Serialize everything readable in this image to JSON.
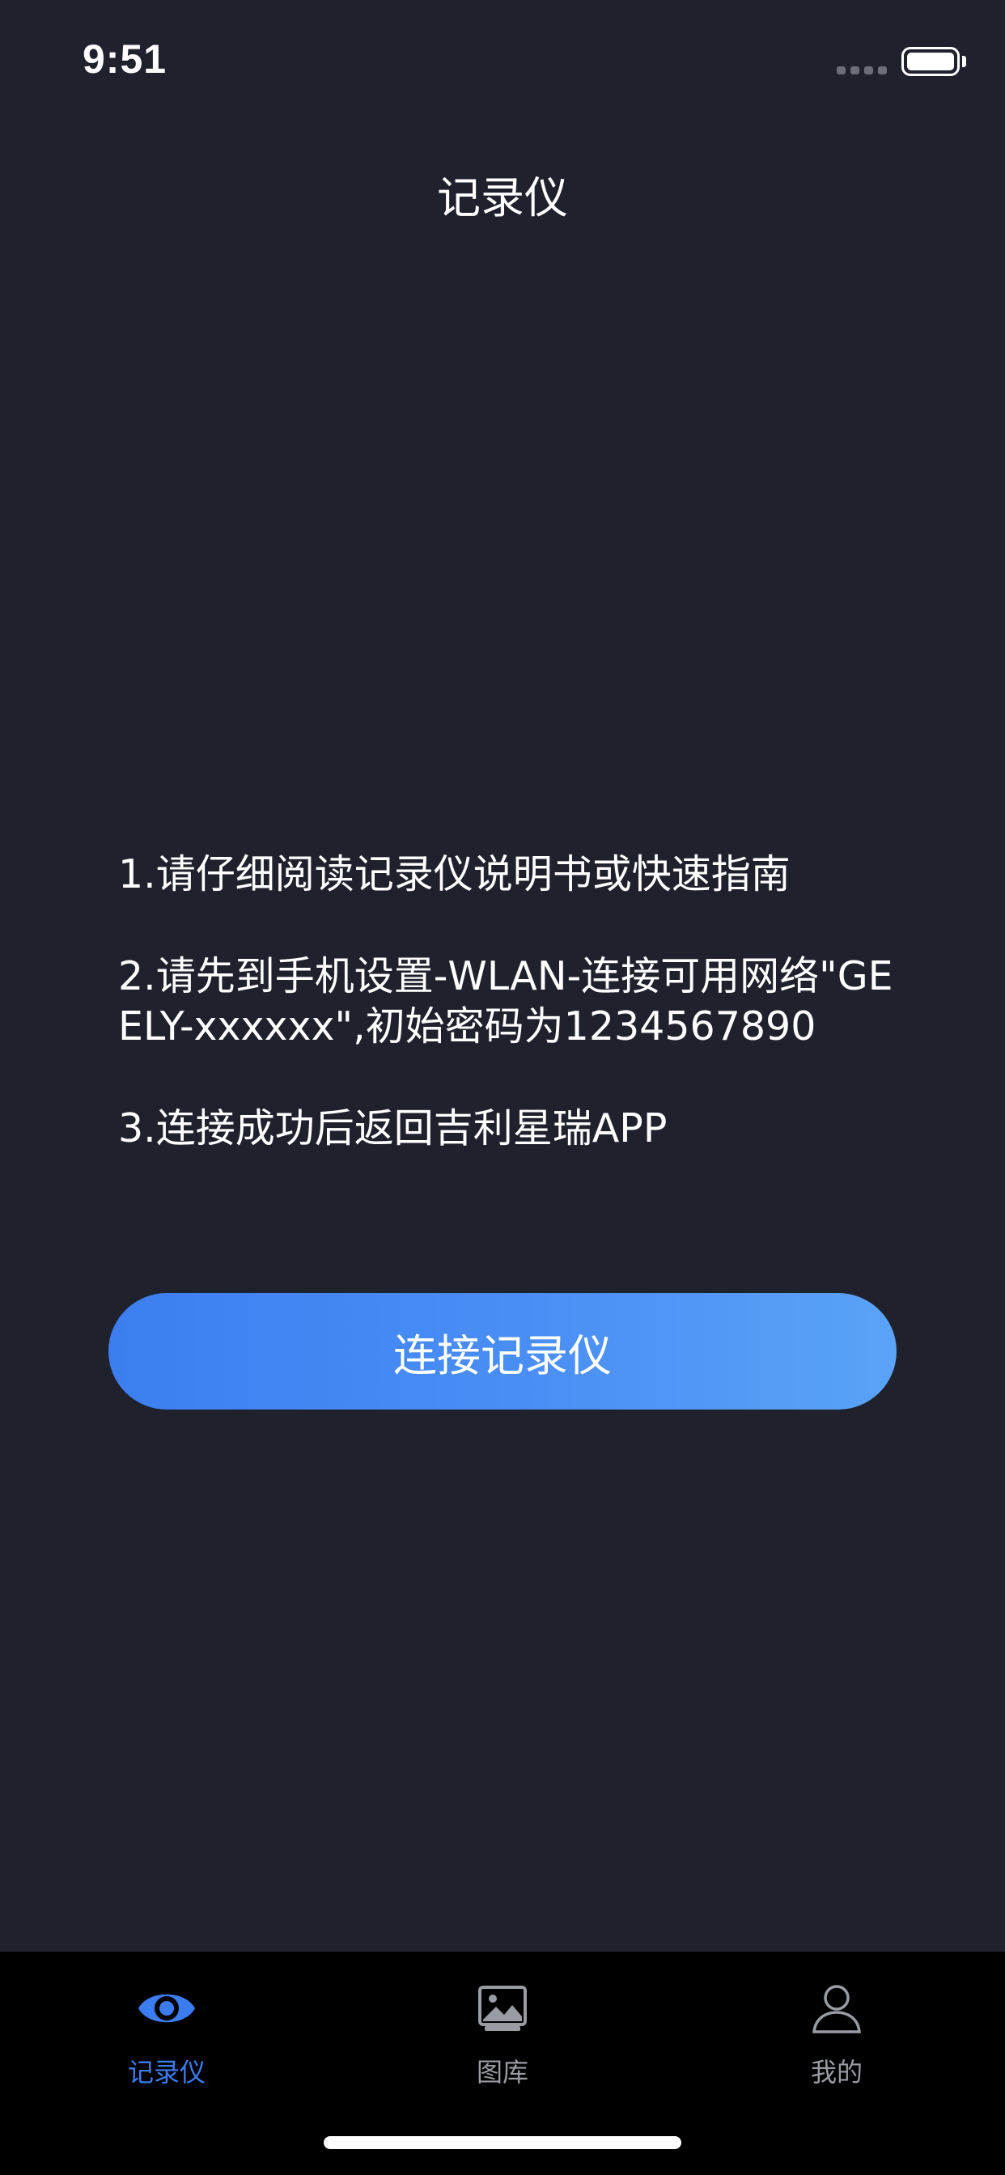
{
  "status_bar": {
    "time": "9:51"
  },
  "nav": {
    "title": "记录仪"
  },
  "instructions": [
    "1.请仔细阅读记录仪说明书或快速指南",
    "2.请先到手机设置-WLAN-连接可用网络\"GEELY-xxxxxx\",初始密码为1234567890",
    "3.连接成功后返回吉利星瑞APP"
  ],
  "connect_button": {
    "label": "连接记录仪"
  },
  "tab_bar": {
    "tabs": [
      {
        "label": "记录仪",
        "icon": "eye-icon",
        "active": true
      },
      {
        "label": "图库",
        "icon": "gallery-icon",
        "active": false
      },
      {
        "label": "我的",
        "icon": "profile-icon",
        "active": false
      }
    ]
  },
  "colors": {
    "background": "#1f212d",
    "accent": "#3b7cf0",
    "tab_inactive": "#9a9ca4"
  }
}
